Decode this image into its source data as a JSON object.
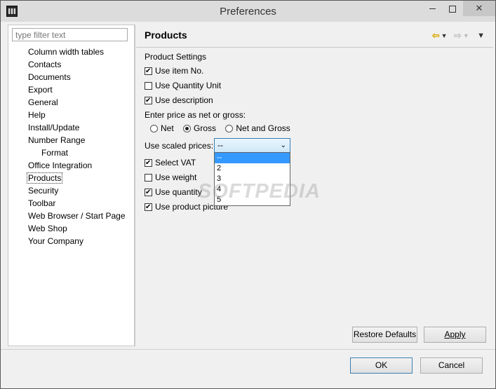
{
  "window": {
    "title": "Preferences"
  },
  "sidebar": {
    "filter_placeholder": "type filter text",
    "items": [
      {
        "label": "Column width tables"
      },
      {
        "label": "Contacts"
      },
      {
        "label": "Documents"
      },
      {
        "label": "Export"
      },
      {
        "label": "General"
      },
      {
        "label": "Help"
      },
      {
        "label": "Install/Update"
      },
      {
        "label": "Number Range"
      },
      {
        "label": "Format"
      },
      {
        "label": "Office Integration"
      },
      {
        "label": "Products"
      },
      {
        "label": "Security"
      },
      {
        "label": "Toolbar"
      },
      {
        "label": "Web Browser / Start Page"
      },
      {
        "label": "Web Shop"
      },
      {
        "label": "Your Company"
      }
    ],
    "selected": "Products"
  },
  "page": {
    "title": "Products",
    "section_label": "Product Settings",
    "checkboxes": {
      "use_item_no": {
        "label": "Use item No.",
        "checked": true
      },
      "use_quantity_unit": {
        "label": "Use Quantity Unit",
        "checked": false
      },
      "use_description": {
        "label": "Use description",
        "checked": true
      },
      "select_vat": {
        "label": "Select VAT",
        "checked": true
      },
      "use_weight": {
        "label": "Use weight",
        "checked": false
      },
      "use_quantity": {
        "label": "Use quantity",
        "checked": true
      },
      "use_product_picture": {
        "label": "Use product picture",
        "checked": true
      }
    },
    "price_label": "Enter price as net or gross:",
    "price_options": {
      "net": "Net",
      "gross": "Gross",
      "net_and_gross": "Net and Gross"
    },
    "price_selected": "Gross",
    "scaled_label": "Use scaled prices:",
    "scaled_value": "--",
    "scaled_options": [
      "--",
      "2",
      "3",
      "4",
      "5"
    ],
    "watermark": "SOFTPEDIA"
  },
  "buttons": {
    "restore_defaults": "Restore Defaults",
    "apply": "Apply",
    "ok": "OK",
    "cancel": "Cancel"
  },
  "icons": {
    "back": "arrow-left-icon",
    "forward": "arrow-right-icon",
    "view_menu": "chevron-down-icon"
  }
}
